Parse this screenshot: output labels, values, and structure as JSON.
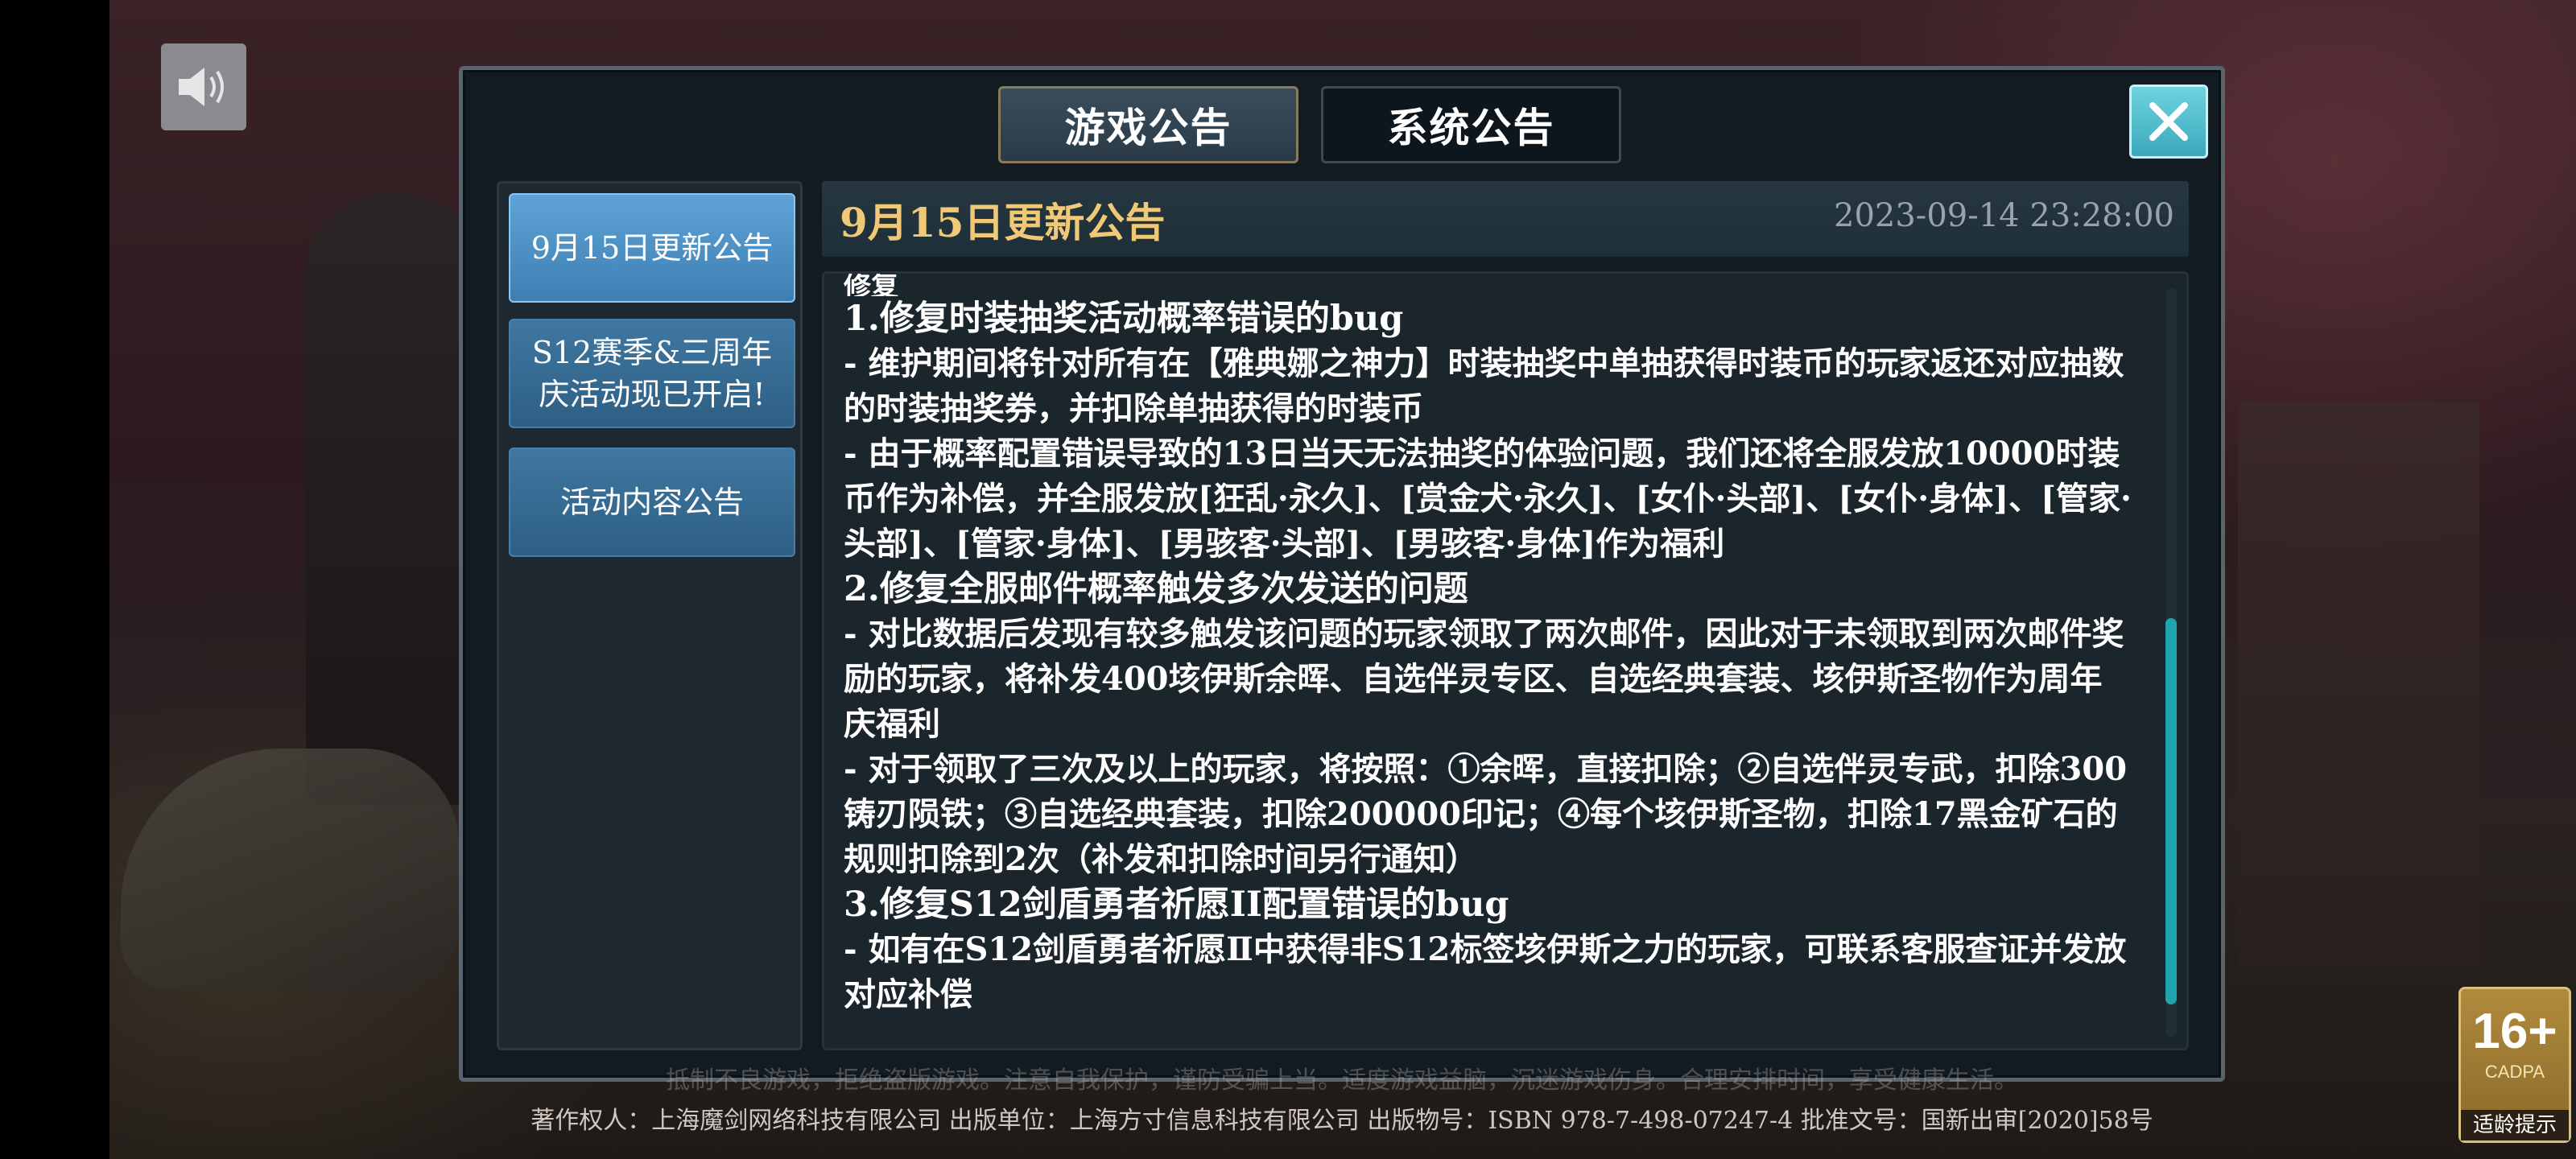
{
  "tabs": [
    {
      "label": "游戏公告",
      "active": true
    },
    {
      "label": "系统公告",
      "active": false
    }
  ],
  "sidebar": {
    "items": [
      {
        "label": "9月15日更新公告",
        "active": true
      },
      {
        "label": "S12赛季&三周年庆活动现已开启!",
        "active": false
      },
      {
        "label": "活动内容公告",
        "active": false
      }
    ]
  },
  "announcement": {
    "title": "9月15日更新公告",
    "date": "2023-09-14  23:28:00",
    "lines": [
      "修复",
      "1.修复时装抽奖活动概率错误的bug",
      "- 维护期间将针对所有在【雅典娜之神力】时装抽奖中单抽获得时装币的玩家返还对应抽数的时装抽奖券，并扣除单抽获得的时装币",
      "- 由于概率配置错误导致的13日当天无法抽奖的体验问题，我们还将全服发放10000时装币作为补偿，并全服发放[狂乱·永久]、[赏金犬·永久]、[女仆·头部]、[女仆·身体]、[管家·头部]、[管家·身体]、[男骇客·头部]、[男骇客·身体]作为福利",
      "2.修复全服邮件概率触发多次发送的问题",
      "- 对比数据后发现有较多触发该问题的玩家领取了两次邮件，因此对于未领取到两次邮件奖励的玩家，将补发400垓伊斯余晖、自选伴灵专区、自选经典套装、垓伊斯圣物作为周年庆福利",
      "- 对于领取了三次及以上的玩家，将按照：①余晖，直接扣除；②自选伴灵专武，扣除300铸刃陨铁；③自选经典套装，扣除200000印记；④每个垓伊斯圣物，扣除17黑金矿石的规则扣除到2次（补发和扣除时间另行通知）",
      "3.修复S12剑盾勇者祈愿II配置错误的bug",
      "- 如有在S12剑盾勇者祈愿Ⅱ中获得非S12标签垓伊斯之力的玩家，可联系客服查证并发放对应补偿"
    ]
  },
  "footer": {
    "line1": "抵制不良游戏，拒绝盗版游戏。注意自我保护，谨防受骗上当。适度游戏益脑，沉迷游戏伤身。合理安排时间，享受健康生活。",
    "line2": "著作权人：上海魔剑网络科技有限公司 出版单位：上海方寸信息科技有限公司 出版物号：ISBN 978-7-498-07247-4 批准文号：国新出审[2020]58号"
  },
  "age_badge": {
    "rating": "16+",
    "org": "CADPA",
    "tip": "适龄提示"
  },
  "icons": {
    "speaker": "speaker-icon",
    "close": "close-icon"
  },
  "colors": {
    "title_gold": "#f0c978",
    "close_cyan": "#4fbfcf",
    "sidebar_active": "#5ea3d7",
    "scrollbar": "#1fa4ad"
  }
}
